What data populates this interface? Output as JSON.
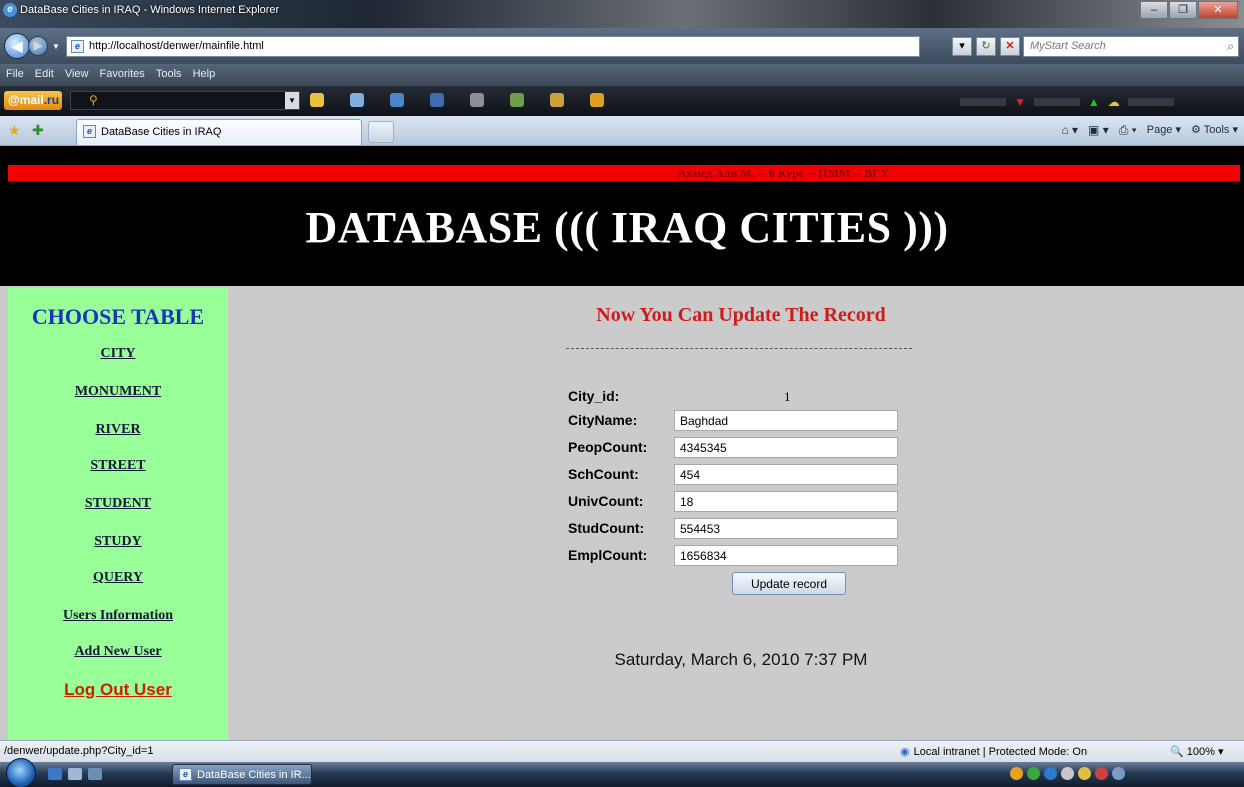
{
  "window": {
    "title": "DataBase Cities in IRAQ - Windows Internet Explorer"
  },
  "address": {
    "url": "http://localhost/denwer/mainfile.html",
    "search_placeholder": "MyStart Search"
  },
  "menu": [
    "File",
    "Edit",
    "View",
    "Favorites",
    "Tools",
    "Help"
  ],
  "mailbar": {
    "logo_prefix": "@mail",
    "logo_suffix": ".ru"
  },
  "tab": {
    "label": "DataBase Cities in IRAQ"
  },
  "commands": {
    "page": "Page",
    "tools": "Tools"
  },
  "page": {
    "author": "Ахмед Али М. -- 6 Курс -- ПММ -- ВГУ",
    "title": "DATABASE ((( IRAQ CITIES )))",
    "sidebar": {
      "title": "CHOOSE TABLE",
      "links": [
        "CITY",
        "MONUMENT",
        "RIVER",
        "STREET",
        "STUDENT",
        "STUDY",
        "QUERY",
        "Users Information",
        "Add New User"
      ],
      "logout": "Log Out User"
    },
    "heading": "Now You Can Update The Record",
    "dashes": "------------------------------------------------------------",
    "form": {
      "city_id_label": "City_id:",
      "city_id_value": "1",
      "fields": [
        {
          "label": "CityName:",
          "value": "Baghdad"
        },
        {
          "label": "PeopCount:",
          "value": "4345345"
        },
        {
          "label": "SchCount:",
          "value": "454"
        },
        {
          "label": "UnivCount:",
          "value": "18"
        },
        {
          "label": "StudCount:",
          "value": "554453"
        },
        {
          "label": "EmplCount:",
          "value": "1656834"
        }
      ],
      "submit": "Update record"
    },
    "datetime": "Saturday, March 6, 2010 7:37 PM"
  },
  "status": {
    "url": "/denwer/update.php?City_id=1",
    "zone": "Local intranet | Protected Mode: On",
    "zoom": "100%"
  },
  "taskbar": {
    "active_window": "DataBase Cities in IR..."
  }
}
